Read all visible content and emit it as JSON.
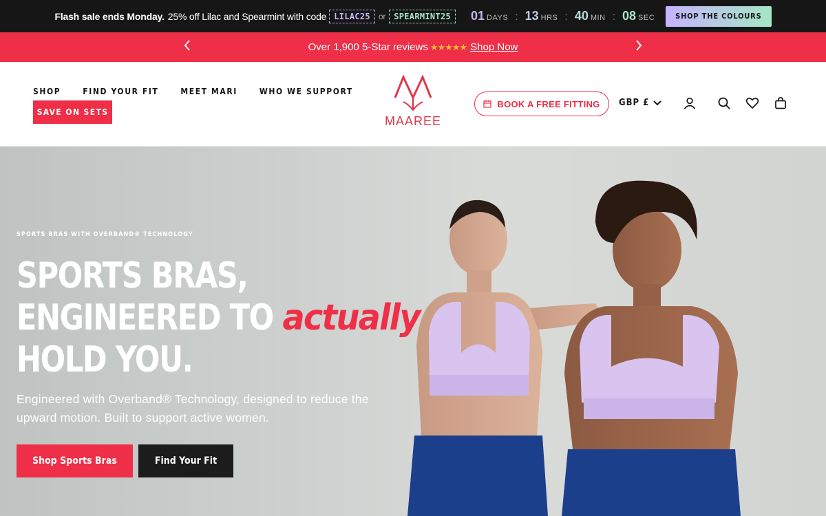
{
  "promo": {
    "lead": "Flash sale ends Monday.",
    "text": "25% off Lilac and Spearmint with code",
    "code1": "LILAC25",
    "or": "or",
    "code2": "SPEARMINT25",
    "countdown": {
      "days": "01",
      "days_label": "DAYS",
      "hrs": "13",
      "hrs_label": "HRS",
      "min": "40",
      "min_label": "MIN",
      "sec": "08",
      "sec_label": "SEC"
    },
    "button": "SHOP THE COLOURS"
  },
  "reviews": {
    "text": "Over 1,900 5-Star reviews",
    "stars": "★★★★★",
    "link": "Shop Now"
  },
  "header": {
    "nav": [
      "SHOP",
      "FIND YOUR FIT",
      "MEET MARI",
      "WHO WE SUPPORT"
    ],
    "save_sets": "SAVE ON SETS",
    "logo": "MAAREE",
    "fitting": "BOOK A FREE FITTING",
    "currency": "GBP £"
  },
  "hero": {
    "eyebrow": "SPORTS BRAS WITH OVERBAND® TECHNOLOGY",
    "title_line1": "SPORTS BRAS,",
    "title_line2": "ENGINEERED TO",
    "title_accent": "actually",
    "title_line3": "HOLD YOU.",
    "subtitle": "Engineered with Overband® Technology, designed to reduce the upward motion. Built to support active women.",
    "cta_primary": "Shop Sports Bras",
    "cta_secondary": "Find Your Fit"
  },
  "colors": {
    "brand_red": "#ef2e47",
    "dark": "#161616",
    "lilac": "#c9b4ff",
    "mint": "#a4e6c2"
  }
}
